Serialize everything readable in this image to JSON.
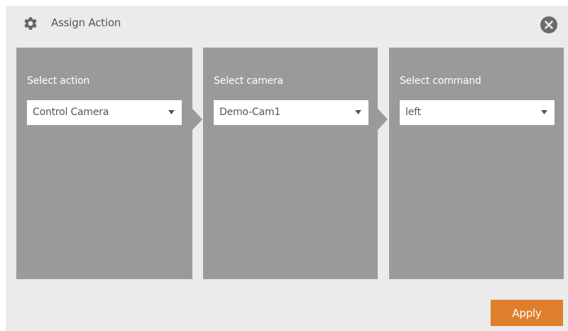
{
  "dialog": {
    "title": "Assign Action",
    "title_icon": "gear-icon",
    "close_icon": "close-icon"
  },
  "panels": [
    {
      "label": "Select action",
      "selected": "Control Camera",
      "caret_icon": "caret-down-icon"
    },
    {
      "label": "Select camera",
      "selected": "Demo-Cam1",
      "caret_icon": "caret-down-icon"
    },
    {
      "label": "Select command",
      "selected": "left",
      "caret_icon": "caret-down-icon"
    }
  ],
  "footer": {
    "apply_label": "Apply"
  },
  "colors": {
    "dialog_bg": "#ebebeb",
    "panel_bg": "#9a9a9a",
    "accent": "#e07f2b",
    "text": "#555555"
  }
}
